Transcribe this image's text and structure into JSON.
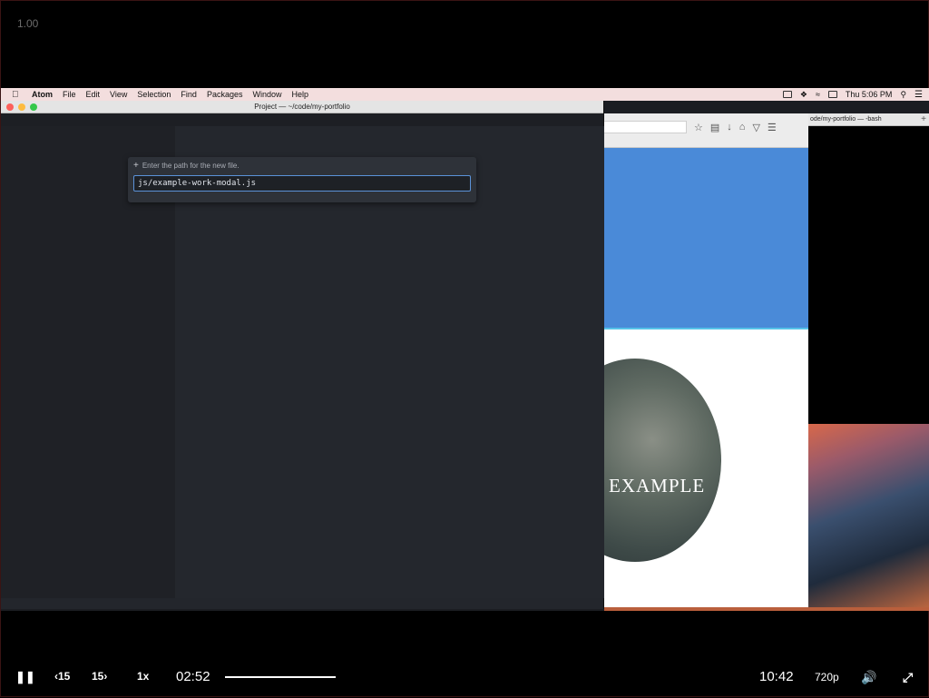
{
  "player": {
    "zoom_label": "1.00",
    "current_time": "02:52",
    "duration": "10:42",
    "speed": "1x",
    "rewind_label": "15",
    "forward_label": "15",
    "quality": "720p",
    "progress_fraction": 1.0
  },
  "menubar": {
    "app": "Atom",
    "items": [
      "File",
      "Edit",
      "View",
      "Selection",
      "Find",
      "Packages",
      "Window",
      "Help"
    ],
    "clock": "Thu 5:06 PM"
  },
  "atom": {
    "title": "Project — ~/code/my-portfolio",
    "modal": {
      "prompt": "Enter the path for the new file.",
      "value": "js/example-work-modal.js"
    }
  },
  "terminal": {
    "title": "ode/my-portfolio — -bash"
  },
  "browser": {
    "hero_text": "EXAMPLE"
  },
  "colors": {
    "accent_blue": "#4a8ad8",
    "input_border": "#5b92d8",
    "editor_bg": "#24272d"
  }
}
